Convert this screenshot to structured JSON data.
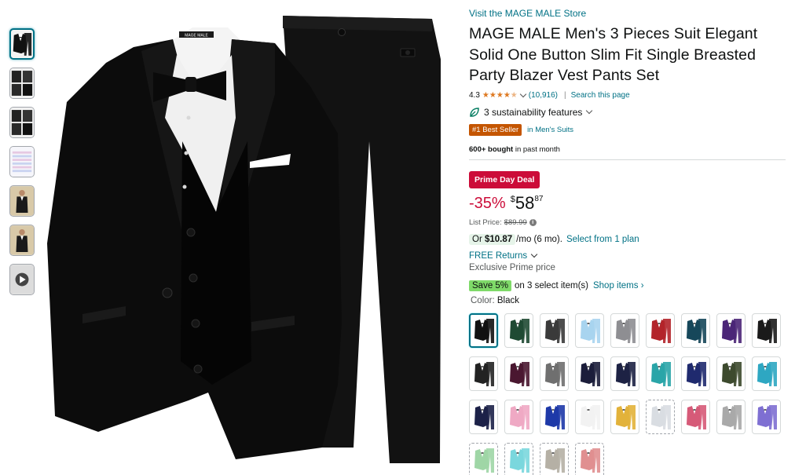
{
  "store_link": "Visit the MAGE MALE Store",
  "product_title": "MAGE MALE Men's 3 Pieces Suit Elegant Solid One Button Slim Fit Single Breasted Party Blazer Vest Pants Set",
  "brand_label_on_image": "MAGE MALE",
  "rating": {
    "value": "4.3",
    "stars_filled": 4.3,
    "count": "(10,916)",
    "separator": "|",
    "search_link": "Search this page"
  },
  "sustainability": "3 sustainability features",
  "best_seller": {
    "badge": "#1 Best Seller",
    "category": "in Men's Suits"
  },
  "bought": {
    "bold": "600+ bought",
    "rest": " in past month"
  },
  "deal_badge": "Prime Day Deal",
  "price": {
    "discount": "-35%",
    "currency": "$",
    "whole": "58",
    "fraction": "87",
    "list_label": "List Price:",
    "list_value": "$89.99"
  },
  "monthly": {
    "or": "Or ",
    "amount": "$10.87",
    "term": "/mo (6 mo).",
    "plan_link": "Select from 1 plan"
  },
  "returns": "FREE Returns",
  "prime_price": "Exclusive Prime price",
  "save": {
    "pill": "Save 5%",
    "text": "on 3 select item(s)",
    "link": "Shop items ›"
  },
  "color": {
    "label": "Color: ",
    "value": "Black"
  },
  "colors": {
    "accent": "#007185",
    "deal": "#cc0c39",
    "best_seller": "#c45500",
    "star": "#de7921",
    "save": "#7fda69"
  },
  "thumbnails": [
    {
      "name": "black-suit",
      "active": true
    },
    {
      "name": "size-chart-grid"
    },
    {
      "name": "detail-collage"
    },
    {
      "name": "size-table"
    },
    {
      "name": "model-photo"
    },
    {
      "name": "model-photo-2"
    },
    {
      "name": "video",
      "video": true
    }
  ],
  "swatches": [
    {
      "color": "#111111",
      "selected": true
    },
    {
      "color": "#1f4a33"
    },
    {
      "color": "#3a3a3a"
    },
    {
      "color": "#a8d4ef"
    },
    {
      "color": "#8e8e92"
    },
    {
      "color": "#b3242a"
    },
    {
      "color": "#16475a"
    },
    {
      "color": "#4b2677"
    },
    {
      "color": "#1a1a1a"
    },
    {
      "color": "#222222"
    },
    {
      "color": "#4a1730"
    },
    {
      "color": "#6f6f6f"
    },
    {
      "color": "#1b1d3a"
    },
    {
      "color": "#1d2244"
    },
    {
      "color": "#2aa5a8"
    },
    {
      "color": "#1f2a6e"
    },
    {
      "color": "#3d4a2e"
    },
    {
      "color": "#2ea7c2"
    },
    {
      "color": "#1c2148"
    },
    {
      "color": "#efa9c4"
    },
    {
      "color": "#1e39a8"
    },
    {
      "color": "#f2f2f2"
    },
    {
      "color": "#e2b23a"
    },
    {
      "color": "#d9dde2",
      "dashed": true
    },
    {
      "color": "#d65a78"
    },
    {
      "color": "#a9a9a9"
    },
    {
      "color": "#7e6fd2"
    },
    {
      "color": "#9fd6a6",
      "dashed": true
    },
    {
      "color": "#7ad7dd",
      "dashed": true
    },
    {
      "color": "#b5b0a5",
      "dashed": true
    },
    {
      "color": "#e08f90",
      "dashed": true
    }
  ]
}
